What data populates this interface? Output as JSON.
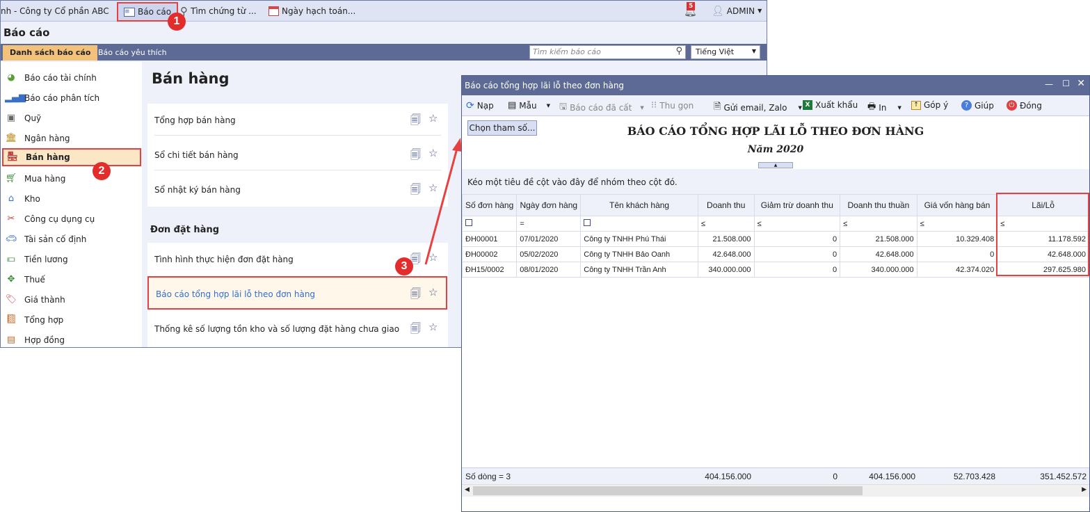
{
  "topbar": {
    "company": "nh - Công ty Cổ phần ABC",
    "report_btn": "Báo cáo",
    "find_voucher": "Tìm chứng từ ...",
    "accounting_date": "Ngày hạch toán...",
    "notif_count": "5",
    "user": "ADMIN"
  },
  "page_title": "Báo cáo",
  "tabs": {
    "list": "Danh sách báo cáo",
    "fav": "Báo cáo yêu thích"
  },
  "search": {
    "placeholder": "Tìm kiếm báo cáo"
  },
  "lang": "Tiếng Việt",
  "sidebar": {
    "items": [
      {
        "label": "Báo cáo tài chính"
      },
      {
        "label": "Báo cáo phân tích"
      },
      {
        "label": "Quỹ"
      },
      {
        "label": "Ngân hàng"
      },
      {
        "label": "Bán hàng"
      },
      {
        "label": "Mua hàng"
      },
      {
        "label": "Kho"
      },
      {
        "label": "Công cụ dụng cụ"
      },
      {
        "label": "Tài sản cố định"
      },
      {
        "label": "Tiền lương"
      },
      {
        "label": "Thuế"
      },
      {
        "label": "Giá thành"
      },
      {
        "label": "Tổng hợp"
      },
      {
        "label": "Hợp đồng"
      }
    ]
  },
  "content": {
    "heading": "Bán hàng",
    "sales_reports": [
      "Tổng hợp bán hàng",
      "Sổ chi tiết bán hàng",
      "Sổ nhật ký bán hàng"
    ],
    "order_section": "Đơn đặt hàng",
    "order_reports": [
      "Tình hình thực hiện đơn đặt hàng",
      "Báo cáo tổng hợp lãi lỗ theo đơn hàng",
      "Thống kê số lượng tồn kho và số lượng đặt hàng chưa giao"
    ]
  },
  "callouts": [
    "1",
    "2",
    "3"
  ],
  "report_window": {
    "title": "Báo cáo tổng hợp lãi lỗ theo đơn hàng",
    "toolbar": {
      "reload": "Nạp",
      "template": "Mẫu",
      "saved": "Báo cáo đã cất",
      "collapse": "Thu gọn",
      "send": "Gửi email, Zalo",
      "export": "Xuất khẩu",
      "print": "In",
      "feedback": "Góp ý",
      "help": "Giúp",
      "close": "Đóng"
    },
    "param_btn": "Chọn tham số...",
    "report_title": "BÁO CÁO TỔNG HỢP LÃI LỖ THEO ĐƠN HÀNG",
    "report_sub": "Năm 2020",
    "group_hint": "Kéo một tiêu đề cột vào đây để nhóm theo cột đó.",
    "columns": [
      "Số đơn hàng",
      "Ngày đơn hàng",
      "Tên khách hàng",
      "Doanh thu",
      "Giảm trừ doanh thu",
      "Doanh thu thuần",
      "Giá vốn hàng bán",
      "Lãi/Lỗ"
    ],
    "filter_ops": {
      "eq": "=",
      "le": "≤"
    },
    "rows": [
      [
        "ĐH00001",
        "07/01/2020",
        "Công ty TNHH Phú Thái",
        "21.508.000",
        "0",
        "21.508.000",
        "10.329.408",
        "11.178.592"
      ],
      [
        "ĐH00002",
        "05/02/2020",
        "Công ty TNHH Bảo Oanh",
        "42.648.000",
        "0",
        "42.648.000",
        "0",
        "42.648.000"
      ],
      [
        "ĐH15/0002",
        "08/01/2020",
        "Công ty TNHH Trần Anh",
        "340.000.000",
        "0",
        "340.000.000",
        "42.374.020",
        "297.625.980"
      ]
    ],
    "footer": {
      "count": "Số dòng = 3",
      "doanh_thu": "404.156.000",
      "giam_tru": "0",
      "thuan": "404.156.000",
      "gia_von": "52.703.428",
      "lai_lo": "351.452.572"
    }
  }
}
